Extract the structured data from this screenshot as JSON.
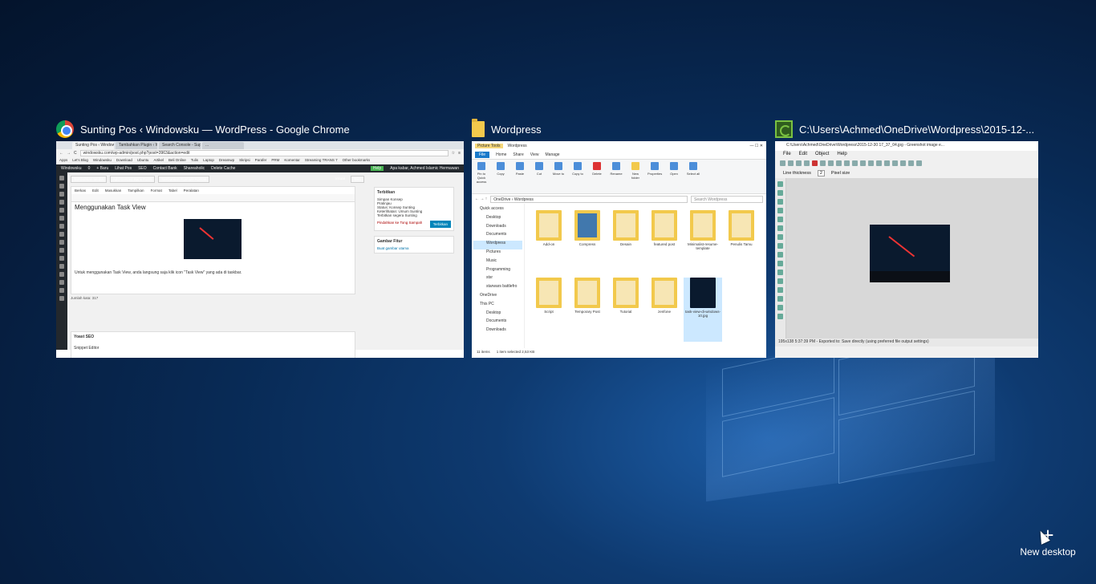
{
  "windows": [
    {
      "title": "Sunting Pos ‹ Windowsku — WordPress - Google Chrome",
      "icon": "chrome-icon",
      "chrome": {
        "tabs": [
          "Sunting Pos ‹ Windowsk...",
          "Tambahkan Plugin ‹ Windo...",
          "Search Console - Super B...",
          "..."
        ],
        "url": "windowsku.com/wp-admin/post.php?post=3963&action=edit",
        "bookmarks": [
          "Apps",
          "Let's Blog",
          "Windowsku",
          "Download",
          "Ubuntu",
          "Artikel",
          "Beli Online",
          "Tulis",
          "Laptop",
          "Dreamwp",
          "Skripsi",
          "Parafer",
          "PRM",
          "Komentar",
          "Streaming TRANS 7",
          "Other bookmarks"
        ],
        "adminbar": [
          "Windowsku",
          "0",
          "+ Baru",
          "Lihat Pos",
          "SEO",
          "Contact Bank",
          "Shareaholic",
          "Delete Cache",
          "Help",
          "Apa kabar, Achmed Islamic Hermawan"
        ],
        "buttons": [
          "Tambahkan Media",
          "Add Contact Bank Form",
          "Tambahkan Formulir Kontak"
        ],
        "editor_tabs": [
          "Visual",
          "Teks"
        ],
        "menubar": [
          "Berkas",
          "Edit",
          "Masukkan",
          "Tampilkan",
          "Format",
          "Tabel",
          "Peralatan"
        ],
        "heading": "Menggunakan Task View",
        "paragraph": "Untuk menggunakan Task View, anda langsung saja klik icon \"Task View\" yang ada di taskbar.",
        "wordcount": "Jumlah kata: 317",
        "publish_box_title": "Terbitkan",
        "publish_lines": [
          "Simpan Konsep",
          "Pratinjau",
          "Status: Konsep Sunting",
          "Keterlihatan: Umum Sunting",
          "Terbitkan segera Sunting"
        ],
        "trash": "Pindahkan ke Tong Sampah",
        "publish_btn": "Terbitkan",
        "featured_title": "Gambar Fitur",
        "featured_link": "Buat gambar utama",
        "yoast": "Yoast SEO",
        "snippet": "Snippet Editor"
      }
    },
    {
      "title": "Wordpress",
      "icon": "folder-icon",
      "explorer": {
        "window_title": "Wordpress",
        "picture_tools": "Picture Tools",
        "tabs": [
          "File",
          "Home",
          "Share",
          "View",
          "Manage"
        ],
        "ribbon": [
          "Pin to Quick access",
          "Copy",
          "Paste",
          "Cut",
          "Move to",
          "Copy to",
          "Delete",
          "Rename",
          "New folder",
          "Properties",
          "Open",
          "Select all"
        ],
        "path": "OneDrive › Wordpress",
        "search_placeholder": "Search Wordpress",
        "nav": [
          {
            "label": "Quick access",
            "sub": false,
            "sel": false
          },
          {
            "label": "Desktop",
            "sub": true,
            "sel": false
          },
          {
            "label": "Downloads",
            "sub": true,
            "sel": false
          },
          {
            "label": "Documents",
            "sub": true,
            "sel": false
          },
          {
            "label": "Wordpress",
            "sub": true,
            "sel": true
          },
          {
            "label": "Pictures",
            "sub": true,
            "sel": false
          },
          {
            "label": "Music",
            "sub": true,
            "sel": false
          },
          {
            "label": "Programming",
            "sub": true,
            "sel": false
          },
          {
            "label": "stsr",
            "sub": true,
            "sel": false
          },
          {
            "label": "starwars battlefro",
            "sub": true,
            "sel": false
          },
          {
            "label": "OneDrive",
            "sub": false,
            "sel": false
          },
          {
            "label": "This PC",
            "sub": false,
            "sel": false
          },
          {
            "label": "Desktop",
            "sub": true,
            "sel": false
          },
          {
            "label": "Documents",
            "sub": true,
            "sel": false
          },
          {
            "label": "Downloads",
            "sub": true,
            "sel": false
          }
        ],
        "items": [
          {
            "label": "Add-on",
            "style": ""
          },
          {
            "label": "Compress",
            "style": "blue"
          },
          {
            "label": "Desain",
            "style": ""
          },
          {
            "label": "featured post",
            "style": ""
          },
          {
            "label": "Minimalist-resume-template",
            "style": ""
          },
          {
            "label": "Penulis Tamu",
            "style": ""
          },
          {
            "label": "Script",
            "style": ""
          },
          {
            "label": "Temporary Post",
            "style": ""
          },
          {
            "label": "Tutorial",
            "style": ""
          },
          {
            "label": "zenfone",
            "style": ""
          },
          {
            "label": "task-view-di-windows-10.jpg",
            "style": "dark"
          }
        ],
        "status_count": "11 items",
        "status_selected": "1 item selected 2,53 KB"
      }
    },
    {
      "title": "C:\\Users\\Achmed\\OneDrive\\Wordpress\\2015-12-...",
      "icon": "greenshot-icon",
      "greenshot": {
        "window_title": "C:\\Users\\Achmed\\OneDrive\\Wordpress\\2015-12-30 17_37_04.jpg - Greenshot image e...",
        "menu": [
          "File",
          "Edit",
          "Object",
          "Help"
        ],
        "line_thickness_label": "Line thickness",
        "line_thickness_value": "2",
        "pixel_size_label": "Pixel size",
        "status": "195x138  5:37:39 PM - Exported to: Save directly (using preferred file output settings)"
      }
    }
  ],
  "new_desktop": {
    "label": "New desktop"
  }
}
